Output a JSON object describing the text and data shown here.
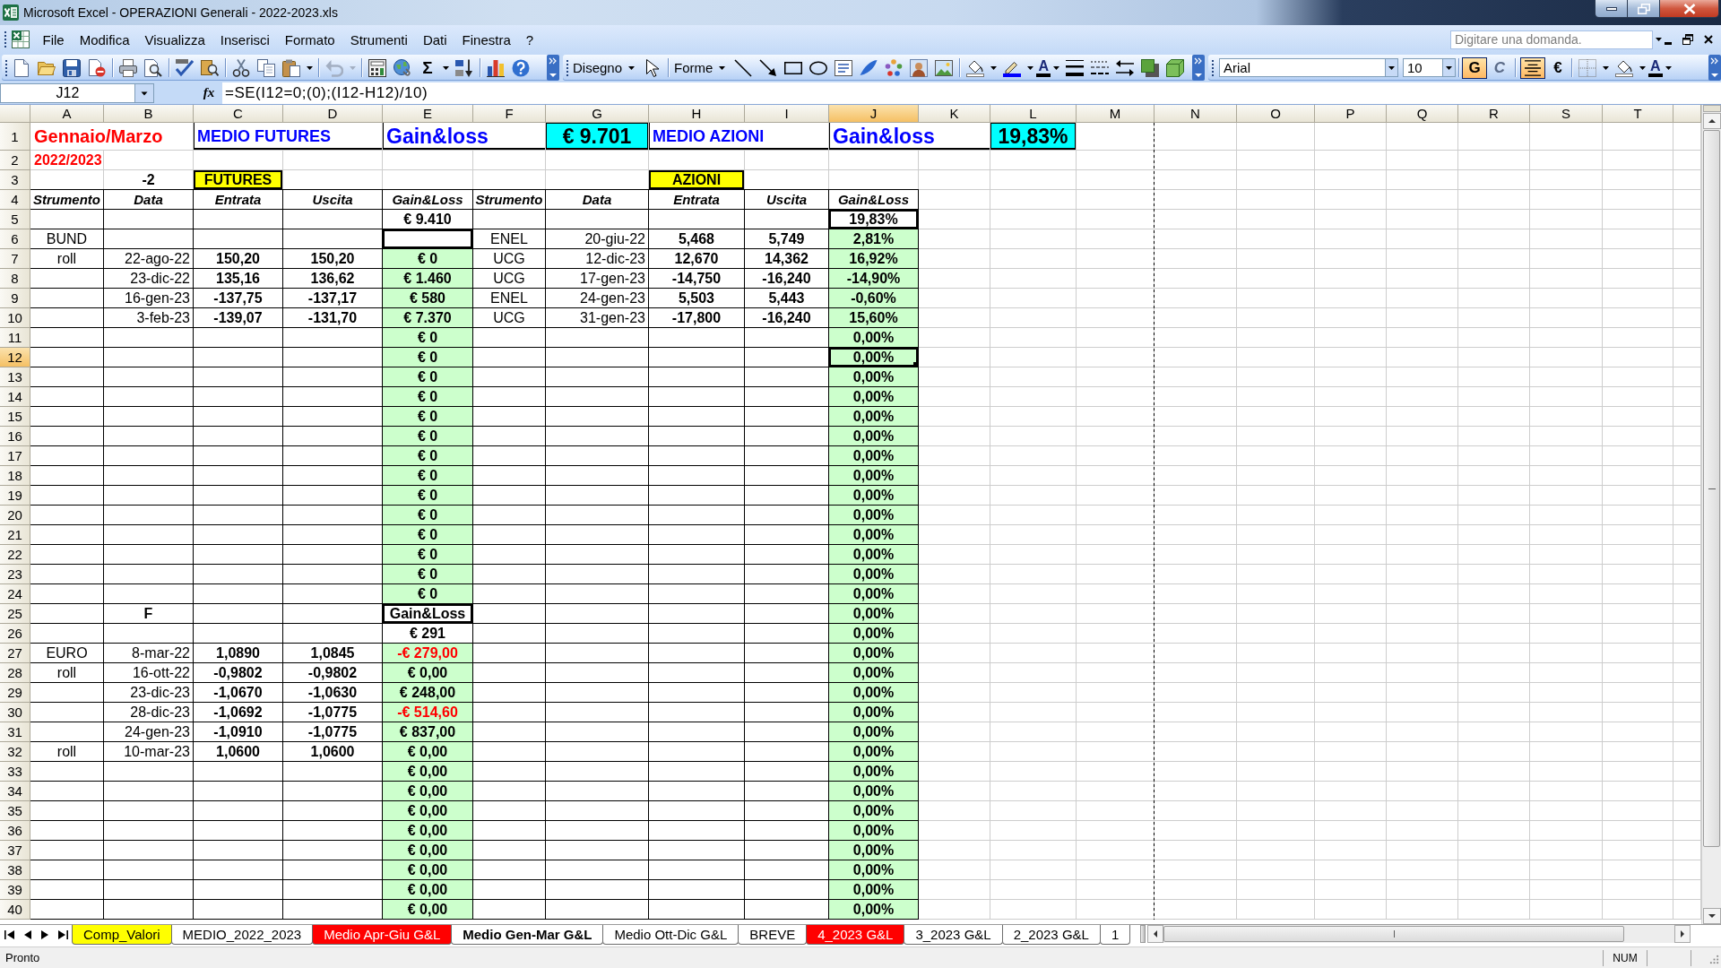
{
  "window": {
    "title": "Microsoft Excel - OPERAZIONI Generali - 2022-2023.xls"
  },
  "menu_bar": {
    "items": [
      "File",
      "Modifica",
      "Visualizza",
      "Inserisci",
      "Formato",
      "Strumenti",
      "Dati",
      "Finestra",
      "?"
    ],
    "question_box": {
      "placeholder": "Digitare una domanda."
    }
  },
  "standard_toolbar": {
    "undo": {
      "disabled": true
    },
    "autosum": "Σ"
  },
  "drawing_toolbar": {
    "menus": [
      "Disegno",
      "Forme"
    ],
    "font_color": "A"
  },
  "formatting_toolbar": {
    "font_box": {
      "value": "Arial"
    },
    "size_box": {
      "value": "10"
    },
    "toggles": [
      {
        "label": "G",
        "kind": "bold",
        "on": true
      },
      {
        "label": "C",
        "kind": "italic",
        "on": false
      }
    ],
    "align_center": {
      "on": true
    },
    "currency": "€",
    "font_color": "A"
  },
  "formula_bar": {
    "name_box": {
      "value": "J12"
    },
    "function_button": "fx",
    "formula": {
      "value": "=SE(I12=0;(0);(I12-H12)/10)"
    }
  },
  "columns": [
    {
      "label": "A",
      "selected": false
    },
    {
      "label": "B",
      "selected": false
    },
    {
      "label": "C",
      "selected": false
    },
    {
      "label": "D",
      "selected": false
    },
    {
      "label": "E",
      "selected": false
    },
    {
      "label": "F",
      "selected": false
    },
    {
      "label": "G",
      "selected": false
    },
    {
      "label": "H",
      "selected": false
    },
    {
      "label": "I",
      "selected": false
    },
    {
      "label": "J",
      "selected": true
    },
    {
      "label": "K",
      "selected": false
    },
    {
      "label": "L",
      "selected": false
    },
    {
      "label": "M",
      "selected": false
    },
    {
      "label": "N",
      "selected": false
    },
    {
      "label": "O",
      "selected": false
    },
    {
      "label": "P",
      "selected": false
    },
    {
      "label": "Q",
      "selected": false
    },
    {
      "label": "R",
      "selected": false
    },
    {
      "label": "S",
      "selected": false
    },
    {
      "label": "T",
      "selected": false
    }
  ],
  "rows": [
    {
      "label": "1",
      "selected": false,
      "kind": "plain",
      "cells": [
        {
          "text": "Gennaio/Marzo",
          "kind": "caption",
          "color": "#ff0000"
        },
        null,
        {
          "text": "MEDIO FUTURES",
          "kind": "title",
          "color": "#0000ff"
        },
        null,
        {
          "text": "Gain&loss",
          "kind": "title-large",
          "color": "#0000ff"
        },
        null,
        {
          "text": "€ 9.701",
          "kind": "total"
        },
        {
          "text": "MEDIO AZIONI",
          "kind": "title",
          "color": "#0000ff"
        },
        null,
        {
          "text": "Gain&loss",
          "kind": "title-large",
          "color": "#0000ff"
        },
        null,
        {
          "text": "19,83%",
          "kind": "total"
        }
      ]
    },
    {
      "label": "2",
      "selected": false,
      "kind": "plain",
      "cells": [
        {
          "text": "2022/2023",
          "kind": "subtitle",
          "color": "#ff0000"
        }
      ]
    },
    {
      "label": "3",
      "selected": false,
      "kind": "plain",
      "cells": [
        null,
        {
          "text": "-2",
          "kind": "number"
        },
        {
          "text": "FUTURES",
          "kind": "heading"
        },
        null,
        null,
        null,
        null,
        {
          "text": "AZIONI",
          "kind": "heading"
        }
      ]
    },
    {
      "label": "4",
      "selected": false,
      "kind": "table",
      "cells": [
        {
          "text": "Strumento",
          "kind": "header"
        },
        {
          "text": "Data",
          "kind": "header"
        },
        {
          "text": "Entrata",
          "kind": "header"
        },
        {
          "text": "Uscita",
          "kind": "header"
        },
        {
          "text": "Gain&Loss",
          "kind": "header"
        },
        {
          "text": "Strumento",
          "kind": "header"
        },
        {
          "text": "Data",
          "kind": "header"
        },
        {
          "text": "Entrata",
          "kind": "header"
        },
        {
          "text": "Uscita",
          "kind": "header"
        },
        {
          "text": "Gain&Loss",
          "kind": "header"
        }
      ]
    },
    {
      "label": "5",
      "selected": false,
      "kind": "table",
      "cells": [
        null,
        null,
        null,
        null,
        {
          "text": "€ 9.410",
          "kind": "number"
        },
        null,
        null,
        null,
        null,
        {
          "text": "19,83%",
          "kind": "framed"
        }
      ]
    },
    {
      "label": "6",
      "selected": false,
      "kind": "table",
      "cells": [
        {
          "text": "BUND",
          "kind": "text"
        },
        null,
        null,
        null,
        {
          "kind": "framed"
        },
        {
          "text": "ENEL",
          "kind": "text"
        },
        {
          "text": "20-giu-22",
          "kind": "date"
        },
        {
          "text": "5,468",
          "kind": "number"
        },
        {
          "text": "5,749",
          "kind": "number"
        },
        {
          "text": "2,81%",
          "kind": "result"
        }
      ]
    },
    {
      "label": "7",
      "selected": false,
      "kind": "table",
      "cells": [
        {
          "text": "roll",
          "kind": "text"
        },
        {
          "text": "22-ago-22",
          "kind": "date"
        },
        {
          "text": "150,20",
          "kind": "number"
        },
        {
          "text": "150,20",
          "kind": "number"
        },
        {
          "text": "€ 0",
          "kind": "result"
        },
        {
          "text": "UCG",
          "kind": "text"
        },
        {
          "text": "12-dic-23",
          "kind": "date"
        },
        {
          "text": "12,670",
          "kind": "number"
        },
        {
          "text": "14,362",
          "kind": "number"
        },
        {
          "text": "16,92%",
          "kind": "result"
        }
      ]
    },
    {
      "label": "8",
      "selected": false,
      "kind": "table",
      "cells": [
        null,
        {
          "text": "23-dic-22",
          "kind": "date"
        },
        {
          "text": "135,16",
          "kind": "number"
        },
        {
          "text": "136,62",
          "kind": "number"
        },
        {
          "text": "€ 1.460",
          "kind": "result"
        },
        {
          "text": "UCG",
          "kind": "text"
        },
        {
          "text": "17-gen-23",
          "kind": "date"
        },
        {
          "text": "-14,750",
          "kind": "number"
        },
        {
          "text": "-16,240",
          "kind": "number"
        },
        {
          "text": "-14,90%",
          "kind": "result"
        }
      ]
    },
    {
      "label": "9",
      "selected": false,
      "kind": "table",
      "cells": [
        null,
        {
          "text": "16-gen-23",
          "kind": "date"
        },
        {
          "text": "-137,75",
          "kind": "number"
        },
        {
          "text": "-137,17",
          "kind": "number"
        },
        {
          "text": "€ 580",
          "kind": "result"
        },
        {
          "text": "ENEL",
          "kind": "text"
        },
        {
          "text": "24-gen-23",
          "kind": "date"
        },
        {
          "text": "5,503",
          "kind": "number"
        },
        {
          "text": "5,443",
          "kind": "number"
        },
        {
          "text": "-0,60%",
          "kind": "result"
        }
      ]
    },
    {
      "label": "10",
      "selected": false,
      "kind": "table",
      "cells": [
        null,
        {
          "text": "3-feb-23",
          "kind": "date"
        },
        {
          "text": "-139,07",
          "kind": "number"
        },
        {
          "text": "-131,70",
          "kind": "number"
        },
        {
          "text": "€ 7.370",
          "kind": "result"
        },
        {
          "text": "UCG",
          "kind": "text"
        },
        {
          "text": "31-gen-23",
          "kind": "date"
        },
        {
          "text": "-17,800",
          "kind": "number"
        },
        {
          "text": "-16,240",
          "kind": "number"
        },
        {
          "text": "15,60%",
          "kind": "result"
        }
      ]
    },
    {
      "label": "11",
      "selected": false,
      "kind": "table",
      "cells": [
        null,
        null,
        null,
        null,
        {
          "text": "€ 0",
          "kind": "result"
        },
        null,
        null,
        null,
        null,
        {
          "text": "0,00%",
          "kind": "result"
        }
      ]
    },
    {
      "label": "12",
      "selected": true,
      "kind": "table",
      "cells": [
        null,
        null,
        null,
        null,
        {
          "text": "€ 0",
          "kind": "result"
        },
        null,
        null,
        null,
        null,
        {
          "text": "0,00%",
          "kind": "result"
        }
      ]
    },
    {
      "label": "13",
      "selected": false,
      "kind": "table",
      "cells": [
        null,
        null,
        null,
        null,
        {
          "text": "€ 0",
          "kind": "result"
        },
        null,
        null,
        null,
        null,
        {
          "text": "0,00%",
          "kind": "result"
        }
      ]
    },
    {
      "label": "14",
      "selected": false,
      "kind": "table",
      "cells": [
        null,
        null,
        null,
        null,
        {
          "text": "€ 0",
          "kind": "result"
        },
        null,
        null,
        null,
        null,
        {
          "text": "0,00%",
          "kind": "result"
        }
      ]
    },
    {
      "label": "15",
      "selected": false,
      "kind": "table",
      "cells": [
        null,
        null,
        null,
        null,
        {
          "text": "€ 0",
          "kind": "result"
        },
        null,
        null,
        null,
        null,
        {
          "text": "0,00%",
          "kind": "result"
        }
      ]
    },
    {
      "label": "16",
      "selected": false,
      "kind": "table",
      "cells": [
        null,
        null,
        null,
        null,
        {
          "text": "€ 0",
          "kind": "result"
        },
        null,
        null,
        null,
        null,
        {
          "text": "0,00%",
          "kind": "result"
        }
      ]
    },
    {
      "label": "17",
      "selected": false,
      "kind": "table",
      "cells": [
        null,
        null,
        null,
        null,
        {
          "text": "€ 0",
          "kind": "result"
        },
        null,
        null,
        null,
        null,
        {
          "text": "0,00%",
          "kind": "result"
        }
      ]
    },
    {
      "label": "18",
      "selected": false,
      "kind": "table",
      "cells": [
        null,
        null,
        null,
        null,
        {
          "text": "€ 0",
          "kind": "result"
        },
        null,
        null,
        null,
        null,
        {
          "text": "0,00%",
          "kind": "result"
        }
      ]
    },
    {
      "label": "19",
      "selected": false,
      "kind": "table",
      "cells": [
        null,
        null,
        null,
        null,
        {
          "text": "€ 0",
          "kind": "result"
        },
        null,
        null,
        null,
        null,
        {
          "text": "0,00%",
          "kind": "result"
        }
      ]
    },
    {
      "label": "20",
      "selected": false,
      "kind": "table",
      "cells": [
        null,
        null,
        null,
        null,
        {
          "text": "€ 0",
          "kind": "result"
        },
        null,
        null,
        null,
        null,
        {
          "text": "0,00%",
          "kind": "result"
        }
      ]
    },
    {
      "label": "21",
      "selected": false,
      "kind": "table",
      "cells": [
        null,
        null,
        null,
        null,
        {
          "text": "€ 0",
          "kind": "result"
        },
        null,
        null,
        null,
        null,
        {
          "text": "0,00%",
          "kind": "result"
        }
      ]
    },
    {
      "label": "22",
      "selected": false,
      "kind": "table",
      "cells": [
        null,
        null,
        null,
        null,
        {
          "text": "€ 0",
          "kind": "result"
        },
        null,
        null,
        null,
        null,
        {
          "text": "0,00%",
          "kind": "result"
        }
      ]
    },
    {
      "label": "23",
      "selected": false,
      "kind": "table",
      "cells": [
        null,
        null,
        null,
        null,
        {
          "text": "€ 0",
          "kind": "result"
        },
        null,
        null,
        null,
        null,
        {
          "text": "0,00%",
          "kind": "result"
        }
      ]
    },
    {
      "label": "24",
      "selected": false,
      "kind": "table",
      "cells": [
        null,
        null,
        null,
        null,
        {
          "text": "€ 0",
          "kind": "result"
        },
        null,
        null,
        null,
        null,
        {
          "text": "0,00%",
          "kind": "result"
        }
      ]
    },
    {
      "label": "25",
      "selected": false,
      "kind": "table",
      "cells": [
        null,
        {
          "text": "F",
          "kind": "number"
        },
        null,
        null,
        {
          "text": "Gain&Loss",
          "kind": "framed"
        },
        null,
        null,
        null,
        null,
        {
          "text": "0,00%",
          "kind": "result"
        }
      ]
    },
    {
      "label": "26",
      "selected": false,
      "kind": "table",
      "cells": [
        null,
        null,
        null,
        null,
        {
          "text": "€ 291",
          "kind": "number"
        },
        null,
        null,
        null,
        null,
        {
          "text": "0,00%",
          "kind": "result"
        }
      ]
    },
    {
      "label": "27",
      "selected": false,
      "kind": "table",
      "cells": [
        {
          "text": "EURO",
          "kind": "text"
        },
        {
          "text": "8-mar-22",
          "kind": "date"
        },
        {
          "text": "1,0890",
          "kind": "number"
        },
        {
          "text": "1,0845",
          "kind": "number"
        },
        {
          "text": "-€ 279,00",
          "kind": "result",
          "color": "#ff0000"
        },
        null,
        null,
        null,
        null,
        {
          "text": "0,00%",
          "kind": "result"
        }
      ]
    },
    {
      "label": "28",
      "selected": false,
      "kind": "table",
      "cells": [
        {
          "text": "roll",
          "kind": "text"
        },
        {
          "text": "16-ott-22",
          "kind": "date"
        },
        {
          "text": "-0,9802",
          "kind": "number"
        },
        {
          "text": "-0,9802",
          "kind": "number"
        },
        {
          "text": "€ 0,00",
          "kind": "result"
        },
        null,
        null,
        null,
        null,
        {
          "text": "0,00%",
          "kind": "result"
        }
      ]
    },
    {
      "label": "29",
      "selected": false,
      "kind": "table",
      "cells": [
        null,
        {
          "text": "23-dic-23",
          "kind": "date"
        },
        {
          "text": "-1,0670",
          "kind": "number"
        },
        {
          "text": "-1,0630",
          "kind": "number"
        },
        {
          "text": "€ 248,00",
          "kind": "result"
        },
        null,
        null,
        null,
        null,
        {
          "text": "0,00%",
          "kind": "result"
        }
      ]
    },
    {
      "label": "30",
      "selected": false,
      "kind": "table",
      "cells": [
        null,
        {
          "text": "28-dic-23",
          "kind": "date"
        },
        {
          "text": "-1,0692",
          "kind": "number"
        },
        {
          "text": "-1,0775",
          "kind": "number"
        },
        {
          "text": "-€ 514,60",
          "kind": "result",
          "color": "#ff0000"
        },
        null,
        null,
        null,
        null,
        {
          "text": "0,00%",
          "kind": "result"
        }
      ]
    },
    {
      "label": "31",
      "selected": false,
      "kind": "table",
      "cells": [
        null,
        {
          "text": "24-gen-23",
          "kind": "date"
        },
        {
          "text": "-1,0910",
          "kind": "number"
        },
        {
          "text": "-1,0775",
          "kind": "number"
        },
        {
          "text": "€ 837,00",
          "kind": "result"
        },
        null,
        null,
        null,
        null,
        {
          "text": "0,00%",
          "kind": "result"
        }
      ]
    },
    {
      "label": "32",
      "selected": false,
      "kind": "table",
      "cells": [
        {
          "text": "roll",
          "kind": "text"
        },
        {
          "text": "10-mar-23",
          "kind": "date"
        },
        {
          "text": "1,0600",
          "kind": "number"
        },
        {
          "text": "1,0600",
          "kind": "number"
        },
        {
          "text": "€ 0,00",
          "kind": "result"
        },
        null,
        null,
        null,
        null,
        {
          "text": "0,00%",
          "kind": "result"
        }
      ]
    },
    {
      "label": "33",
      "selected": false,
      "kind": "table",
      "cells": [
        null,
        null,
        null,
        null,
        {
          "text": "€ 0,00",
          "kind": "result"
        },
        null,
        null,
        null,
        null,
        {
          "text": "0,00%",
          "kind": "result"
        }
      ]
    },
    {
      "label": "34",
      "selected": false,
      "kind": "table",
      "cells": [
        null,
        null,
        null,
        null,
        {
          "text": "€ 0,00",
          "kind": "result"
        },
        null,
        null,
        null,
        null,
        {
          "text": "0,00%",
          "kind": "result"
        }
      ]
    },
    {
      "label": "35",
      "selected": false,
      "kind": "table",
      "cells": [
        null,
        null,
        null,
        null,
        {
          "text": "€ 0,00",
          "kind": "result"
        },
        null,
        null,
        null,
        null,
        {
          "text": "0,00%",
          "kind": "result"
        }
      ]
    },
    {
      "label": "36",
      "selected": false,
      "kind": "table",
      "cells": [
        null,
        null,
        null,
        null,
        {
          "text": "€ 0,00",
          "kind": "result"
        },
        null,
        null,
        null,
        null,
        {
          "text": "0,00%",
          "kind": "result"
        }
      ]
    },
    {
      "label": "37",
      "selected": false,
      "kind": "table",
      "cells": [
        null,
        null,
        null,
        null,
        {
          "text": "€ 0,00",
          "kind": "result"
        },
        null,
        null,
        null,
        null,
        {
          "text": "0,00%",
          "kind": "result"
        }
      ]
    },
    {
      "label": "38",
      "selected": false,
      "kind": "table",
      "cells": [
        null,
        null,
        null,
        null,
        {
          "text": "€ 0,00",
          "kind": "result"
        },
        null,
        null,
        null,
        null,
        {
          "text": "0,00%",
          "kind": "result"
        }
      ]
    },
    {
      "label": "39",
      "selected": false,
      "kind": "table",
      "cells": [
        null,
        null,
        null,
        null,
        {
          "text": "€ 0,00",
          "kind": "result"
        },
        null,
        null,
        null,
        null,
        {
          "text": "0,00%",
          "kind": "result"
        }
      ]
    },
    {
      "label": "40",
      "selected": false,
      "kind": "table",
      "cells": [
        null,
        null,
        null,
        null,
        {
          "text": "€ 0,00",
          "kind": "result"
        },
        null,
        null,
        null,
        null,
        {
          "text": "0,00%",
          "kind": "result"
        }
      ]
    }
  ],
  "sheet_tabs": [
    {
      "label": "Comp_Valori",
      "selected": false,
      "color": "#ffff00"
    },
    {
      "label": "MEDIO_2022_2023",
      "selected": false
    },
    {
      "label": "Medio Apr-Giu G&L",
      "selected": false,
      "color": "#ff0000"
    },
    {
      "label": "Medio Gen-Mar G&L",
      "selected": true
    },
    {
      "label": "Medio Ott-Dic G&L",
      "selected": false
    },
    {
      "label": "BREVE",
      "selected": false
    },
    {
      "label": "4_2023 G&L",
      "selected": false,
      "color": "#ff0000"
    },
    {
      "label": "3_2023 G&L",
      "selected": false
    },
    {
      "label": "2_2023 G&L",
      "selected": false
    },
    {
      "label": "1",
      "selected": false
    }
  ],
  "status_bar": {
    "text": "Pronto",
    "indicators": [
      "NUM"
    ]
  }
}
